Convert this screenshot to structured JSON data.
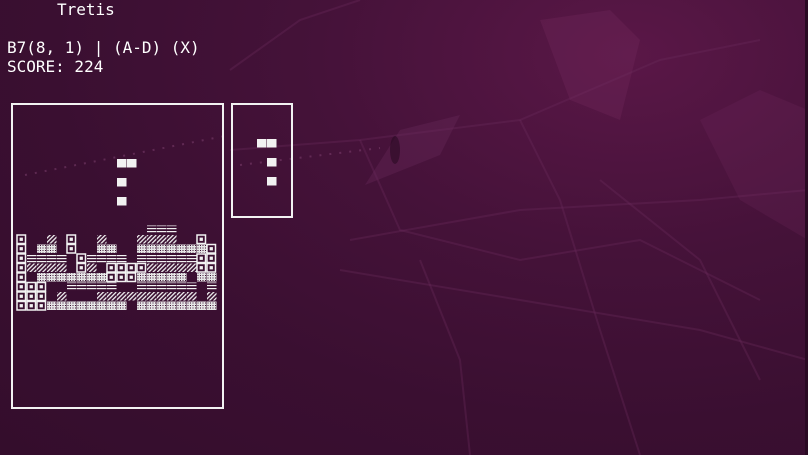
{
  "app": {
    "title": "Tretis"
  },
  "status": {
    "piece_line": "B7(8, 1) | (A-D) (X)",
    "score_line": "SCORE: 224"
  },
  "colors": {
    "cell": "#f2f2f2",
    "background": "#3a0f31"
  },
  "board": {
    "columns": 20,
    "rows": 15,
    "rows_cells": [
      "                    ",
      "                    ",
      "          22        ",
      "                    ",
      "          2         ",
      "                    ",
      "          2         ",
      "                    ",
      "                    ",
      "             333    ",
      "1  3 1  3   3333  1 ",
      "1 33 1  33  33333331",
      "13333 13333 33333311",
      "13333 13 11113333311",
      "1 333333311133333 33",
      "111  33333  333333 3",
      "111 3   3333333333 3",
      "11133333333 33333333"
    ]
  },
  "preview": {
    "columns": 5,
    "rows_cells": [
      "  22 ",
      "     ",
      "   2 ",
      "     ",
      "   2 "
    ]
  }
}
